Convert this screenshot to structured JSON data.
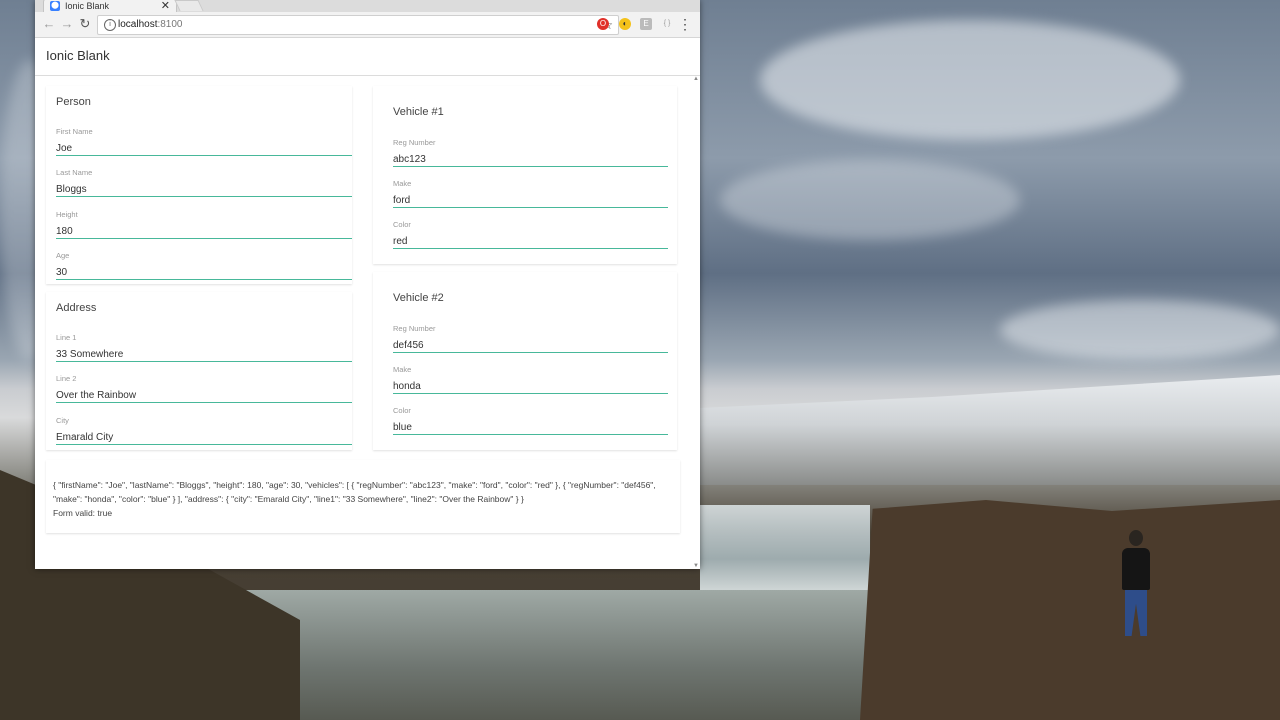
{
  "browser": {
    "tab_title": "Ionic Blank",
    "tab_favicon": "ionic-icon",
    "url_host": "localhost",
    "url_port": ":8100"
  },
  "app": {
    "title": "Ionic Blank"
  },
  "person": {
    "title": "Person",
    "fields": [
      {
        "label": "First Name",
        "value": "Joe"
      },
      {
        "label": "Last Name",
        "value": "Bloggs"
      },
      {
        "label": "Height",
        "value": "180"
      },
      {
        "label": "Age",
        "value": "30"
      }
    ]
  },
  "address": {
    "title": "Address",
    "fields": [
      {
        "label": "Line 1",
        "value": "33 Somewhere"
      },
      {
        "label": "Line 2",
        "value": "Over the Rainbow"
      },
      {
        "label": "City",
        "value": "Emarald City"
      }
    ]
  },
  "vehicles": [
    {
      "title": "Vehicle #1",
      "fields": [
        {
          "label": "Reg Number",
          "value": "abc123"
        },
        {
          "label": "Make",
          "value": "ford"
        },
        {
          "label": "Color",
          "value": "red"
        }
      ]
    },
    {
      "title": "Vehicle #2",
      "fields": [
        {
          "label": "Reg Number",
          "value": "def456"
        },
        {
          "label": "Make",
          "value": "honda"
        },
        {
          "label": "Color",
          "value": "blue"
        }
      ]
    }
  ],
  "output": {
    "json_line": "{ \"firstName\": \"Joe\", \"lastName\": \"Bloggs\", \"height\": 180, \"age\": 30, \"vehicles\": [ { \"regNumber\": \"abc123\", \"make\": \"ford\", \"color\": \"red\" }, { \"regNumber\": \"def456\", \"make\": \"honda\", \"color\": \"blue\" } ], \"address\": { \"city\": \"Emarald City\", \"line1\": \"33 Somewhere\", \"line2\": \"Over the Rainbow\" } }",
    "form_valid": "Form valid: true"
  },
  "colors": {
    "input_underline": "#47b89a",
    "ionic_blue": "#3880ff"
  }
}
